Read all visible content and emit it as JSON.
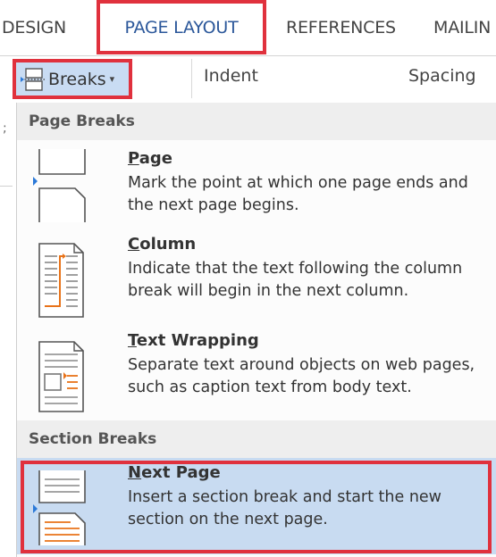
{
  "ribbon": {
    "tabs": [
      {
        "label": "DESIGN"
      },
      {
        "label": "PAGE LAYOUT",
        "active": true
      },
      {
        "label": "REFERENCES"
      },
      {
        "label": "MAILIN"
      }
    ],
    "breaks_label": "Breaks",
    "breaks_caret": "▾",
    "indent_label": "Indent",
    "spacing_label": "Spacing"
  },
  "left_edge_mark": ";",
  "menu": {
    "page_breaks_header": "Page Breaks",
    "section_breaks_header": "Section Breaks",
    "items": [
      {
        "title_prefix": "",
        "title_underlined": "P",
        "title_rest": "age",
        "desc": "Mark the point at which one page ends and the next page begins.",
        "icon": "page-break-icon"
      },
      {
        "title_prefix": "",
        "title_underlined": "C",
        "title_rest": "olumn",
        "desc": "Indicate that the text following the column break will begin in the next column.",
        "icon": "column-break-icon"
      },
      {
        "title_prefix": "",
        "title_underlined": "T",
        "title_rest": "ext Wrapping",
        "desc": "Separate text around objects on web pages, such as caption text from body text.",
        "icon": "text-wrapping-icon"
      },
      {
        "title_prefix": "",
        "title_underlined": "N",
        "title_rest": "ext Page",
        "desc": "Insert a section break and start the new section on the next page.",
        "icon": "next-page-icon",
        "selected": true
      }
    ]
  },
  "colors": {
    "highlight_red": "#e0313d",
    "selected_bg": "#c8dbf1",
    "active_tab_text": "#2b579a",
    "arrow_blue": "#2b79d8",
    "accent_orange": "#e8731a"
  }
}
